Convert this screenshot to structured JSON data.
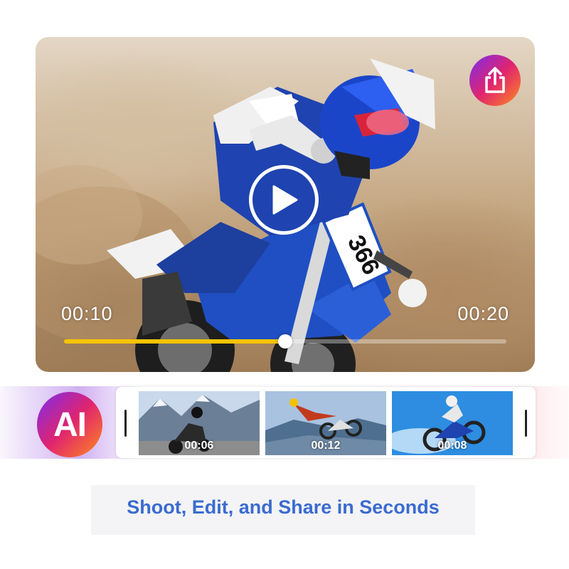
{
  "player": {
    "current_time": "00:10",
    "total_time": "00:20",
    "progress": 0.5,
    "bib_number": "366",
    "share_icon": "share-icon",
    "play_icon": "play-icon",
    "progress_color": "#f5c400"
  },
  "ai_badge": {
    "label": "AI"
  },
  "clips": [
    {
      "time": "00:06",
      "scene": "mountain road motorcycle"
    },
    {
      "time": "00:12",
      "scene": "freestyle motocross jump"
    },
    {
      "time": "00:08",
      "scene": "motocross jump blue sky"
    }
  ],
  "tagline": "Shoot, Edit, and Share in Seconds",
  "colors": {
    "accent_gradient_start": "#7a2df0",
    "accent_gradient_mid": "#e0246f",
    "accent_gradient_end": "#ff8a1c",
    "tagline_color": "#3a6bd0"
  }
}
